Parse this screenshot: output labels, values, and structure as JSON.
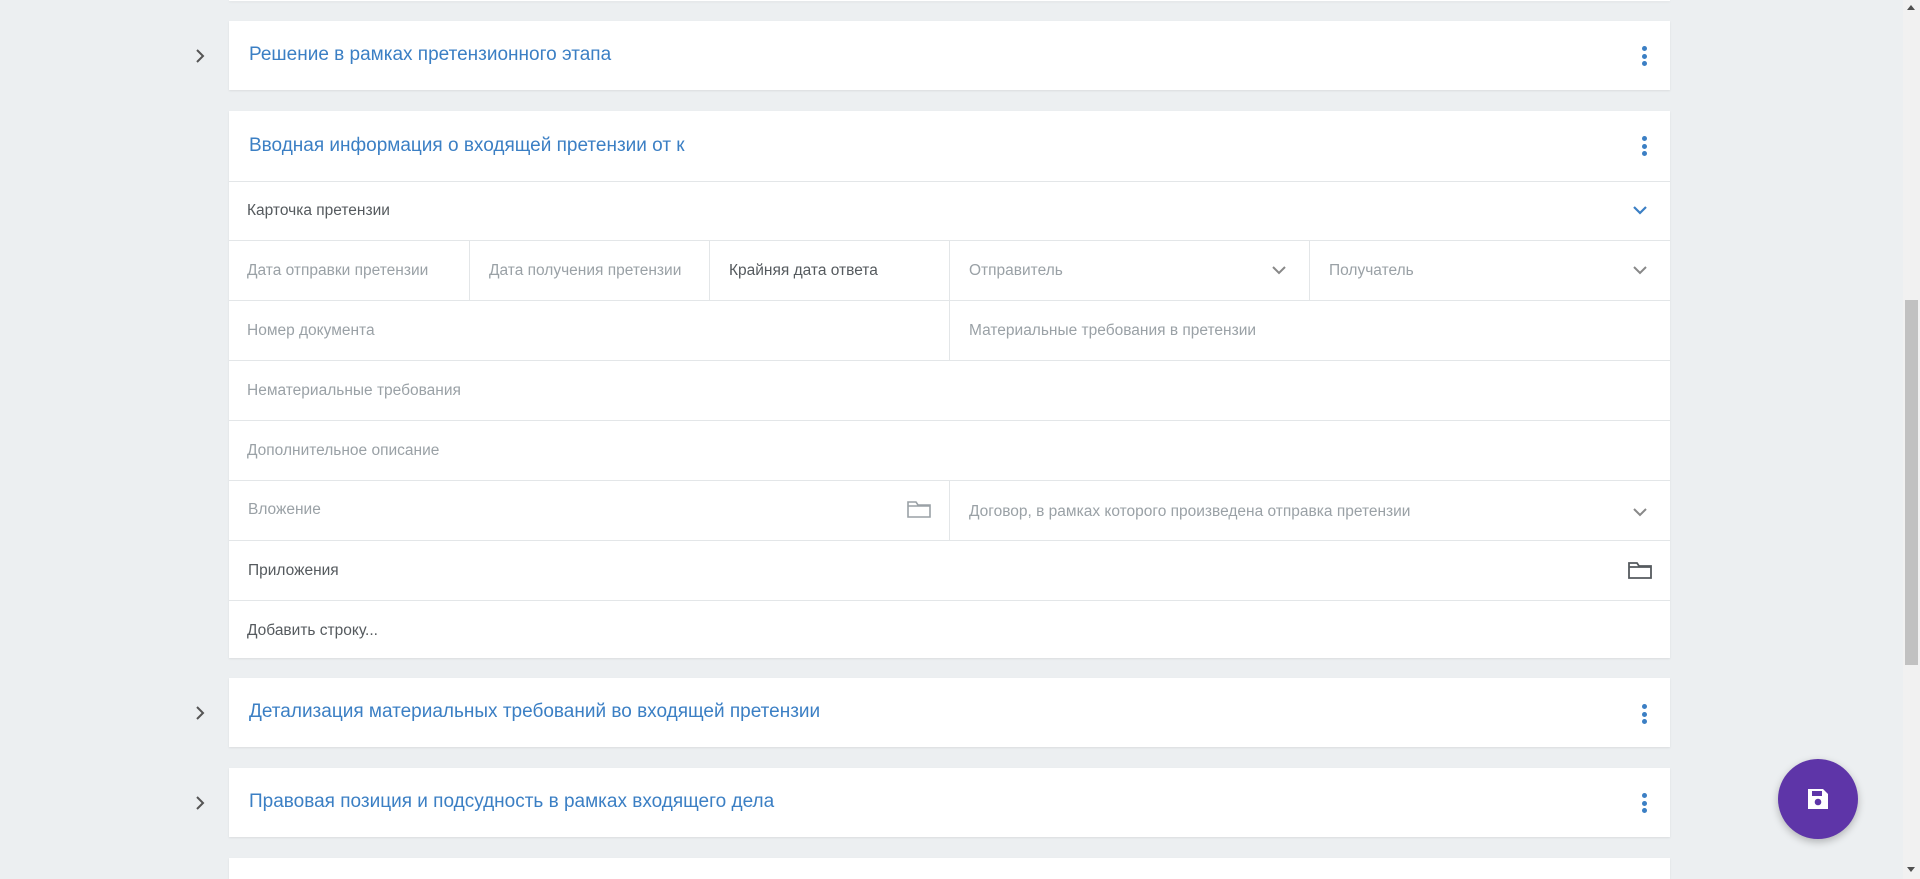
{
  "sections": [
    {
      "title": "Решение в рамках претензионного этапа"
    },
    {
      "title": "Вводная информация о входящей претензии от к"
    },
    {
      "title": "Детализация материальных требований во входящей претензии"
    },
    {
      "title": "Правовая позиция и подсудность в рамках входящего дела"
    }
  ],
  "form": {
    "card_title": "Карточка претензии",
    "fields": {
      "send_date": "Дата отправки претензии",
      "receive_date": "Дата получения претензии",
      "deadline": "Крайняя дата ответа",
      "sender": "Отправитель",
      "recipient": "Получатель",
      "doc_number": "Номер документа",
      "material_reqs": "Материальные требования в претензии",
      "nonmaterial_reqs": "Нематериальные требования",
      "extra_desc": "Дополнительное описание",
      "attachment": "Вложение",
      "contract": "Договор, в рамках которого произведена отправка претензии"
    },
    "appendices_label": "Приложения",
    "add_row_label": "Добавить строку..."
  },
  "icons": {
    "expand": "chevron-right-icon",
    "menu": "kebab-menu-icon",
    "dropdown": "chevron-down-icon",
    "folder": "folder-icon",
    "save": "floppy-disk-icon"
  },
  "colors": {
    "accent": "#3b7fc4",
    "fab": "#5e35a8",
    "background": "#eceff1"
  }
}
